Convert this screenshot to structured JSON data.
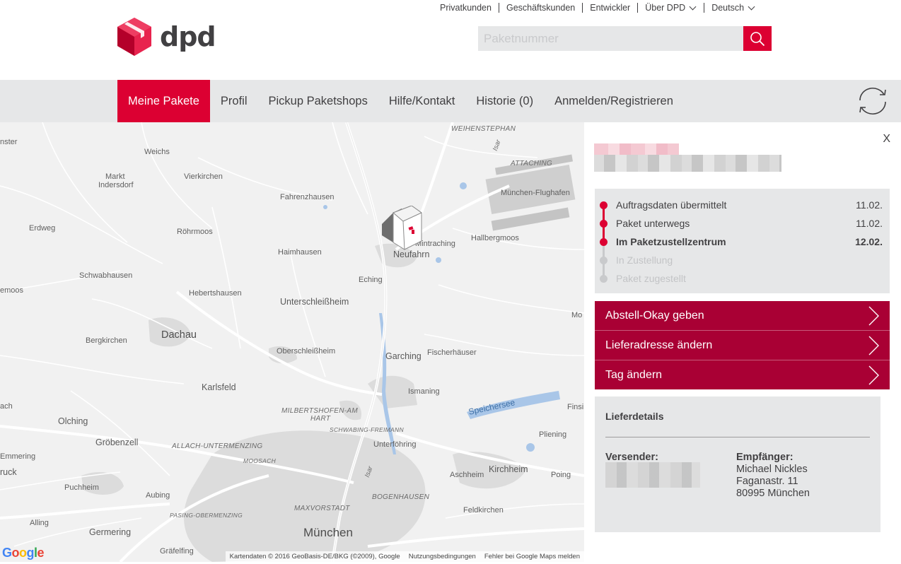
{
  "utility_nav": {
    "items": [
      {
        "label": "Privatkunden",
        "dropdown": false
      },
      {
        "label": "Geschäftskunden",
        "dropdown": false
      },
      {
        "label": "Entwickler",
        "dropdown": false
      },
      {
        "label": "Über DPD",
        "dropdown": true
      },
      {
        "label": "Deutsch",
        "dropdown": true
      }
    ]
  },
  "logo": {
    "word": "dpd",
    "icon": "dpd-cube-icon",
    "color": "#dc0032"
  },
  "search": {
    "placeholder": "Paketnummer",
    "value": "",
    "icon": "search-icon"
  },
  "main_nav": {
    "items": [
      {
        "label": "Meine Pakete",
        "active": true
      },
      {
        "label": "Profil",
        "active": false
      },
      {
        "label": "Pickup Paketshops",
        "active": false
      },
      {
        "label": "Hilfe/Kontakt",
        "active": false
      },
      {
        "label": "Historie (0)",
        "active": false
      },
      {
        "label": "Anmelden/Registrieren",
        "active": false
      }
    ],
    "refresh_icon": "refresh-icon"
  },
  "map": {
    "labels": {
      "weihenstephan": "WEIHENSTEPHAN",
      "isar_north": "Isar",
      "attaching": "ATTACHING",
      "muenchen_flughafen": "München-Flughafen",
      "nster": "nster",
      "weichs": "Weichs",
      "markt_indersdorf_1": "Markt",
      "markt_indersdorf_2": "Indersdorf",
      "vierkirchen": "Vierkirchen",
      "fahrenzhausen": "Fahrenzhausen",
      "erdweg": "Erdweg",
      "roehrmoos": "Röhrmoos",
      "mintraching": "Mintraching",
      "hallbergmoos": "Hallbergmoos",
      "haimhausen": "Haimhausen",
      "neufahrn": "Neufahrn",
      "schwabhausen": "Schwabhausen",
      "eching": "Eching",
      "emoos": "emoos",
      "hebertshausen": "Hebertshausen",
      "unterschleissheim": "Unterschleißheim",
      "mo": "Mo",
      "dachau": "Dachau",
      "bergkirchen": "Bergkirchen",
      "oberschleissheim": "Oberschleißheim",
      "fischerhaeuser": "Fischerhäuser",
      "garching": "Garching",
      "karlsfeld": "Karlsfeld",
      "ismaning": "Ismaning",
      "ach": "ach",
      "speichersee": "Speichersee",
      "finsi": "Finsi",
      "milbertshofen_1": "MILBERTSHOFEN-AM",
      "milbertshofen_2": "HART",
      "olching": "Olching",
      "schwabing_freimann": "SCHWABING-FREIMANN",
      "groebenzell": "Gröbenzell",
      "unterfoehring": "Unterföhring",
      "pliening": "Pliening",
      "allach": "ALLACH-UNTERMENZING",
      "emmering": "Emmering",
      "moosach": "MOOSACH",
      "ruck": "ruck",
      "isar_south": "Isar",
      "kirchheim": "Kirchheim",
      "aschheim": "Aschheim",
      "poing": "Poing",
      "puchheim": "Puchheim",
      "aubing": "Aubing",
      "bogenhausen": "BOGENHAUSEN",
      "maxvorstadt": "MAXVORSTADT",
      "feldkirchen": "Feldkirchen",
      "pasing": "PASING-OBERMENZING",
      "alling": "Alling",
      "germering": "Germering",
      "muenchen": "München",
      "graefelfing": "Gräfelfing"
    },
    "footer": {
      "attribution": "Kartendaten © 2016 GeoBasis-DE/BKG (©2009), Google",
      "terms": "Nutzungsbedingungen",
      "report": "Fehler bei Google Maps melden"
    },
    "google_logo": [
      "G",
      "o",
      "o",
      "g",
      "l",
      "e"
    ],
    "marker_icon": "parcel-box-marker-icon"
  },
  "panel": {
    "close_label": "X",
    "status": [
      {
        "label": "Auftragsdaten übermittelt",
        "date": "11.02.",
        "state": "done"
      },
      {
        "label": "Paket unterwegs",
        "date": "11.02.",
        "state": "done"
      },
      {
        "label": "Im Paketzustellzentrum",
        "date": "12.02.",
        "state": "current"
      },
      {
        "label": "In Zustellung",
        "date": "",
        "state": "pending"
      },
      {
        "label": "Paket zugestellt",
        "date": "",
        "state": "pending"
      }
    ],
    "actions": [
      {
        "label": "Abstell-Okay geben"
      },
      {
        "label": "Lieferadresse ändern"
      },
      {
        "label": "Tag ändern"
      }
    ],
    "details": {
      "title": "Lieferdetails",
      "sender_heading": "Versender:",
      "recipient_heading": "Empfänger:",
      "recipient_lines": [
        "Michael Nickles",
        "Faganastr. 11",
        "80995 München"
      ]
    }
  },
  "colors": {
    "brand_red": "#dc0032",
    "action_red": "#a90034",
    "nav_bg": "#e6e7e8",
    "text": "#414042"
  }
}
